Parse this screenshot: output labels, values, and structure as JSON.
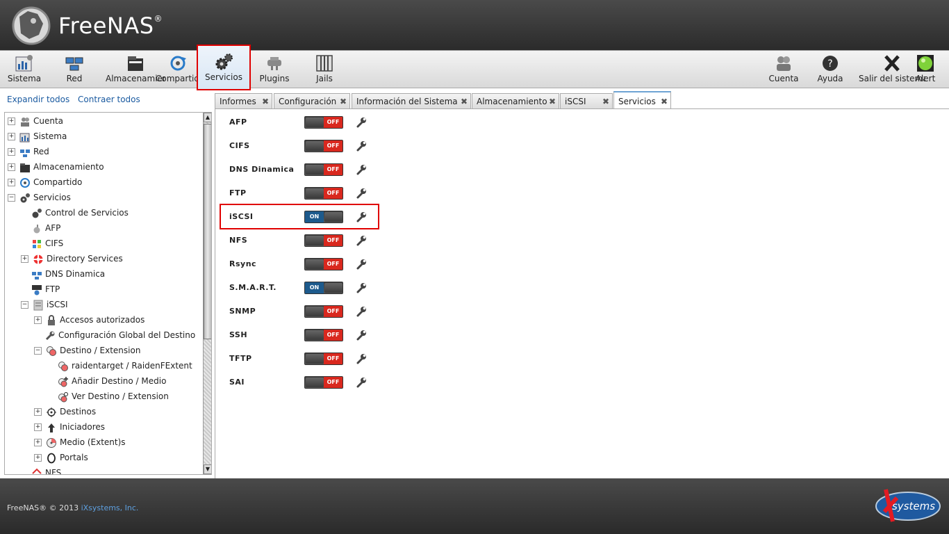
{
  "header": {
    "brand": "FreeNAS",
    "reg": "®"
  },
  "toolbar": {
    "left": [
      {
        "label": "Sistema"
      },
      {
        "label": "Red"
      },
      {
        "label": "Almacenamiento"
      },
      {
        "label": "Compartido"
      },
      {
        "label": "Servicios"
      },
      {
        "label": "Plugins"
      },
      {
        "label": "Jails"
      }
    ],
    "right": [
      {
        "label": "Cuenta"
      },
      {
        "label": "Ayuda"
      },
      {
        "label": "Salir del sistema"
      },
      {
        "label": "Alert"
      }
    ]
  },
  "tree": {
    "expand_all": "Expandir todos",
    "collapse_all": "Contraer todos",
    "items": [
      {
        "label": "Cuenta"
      },
      {
        "label": "Sistema"
      },
      {
        "label": "Red"
      },
      {
        "label": "Almacenamiento"
      },
      {
        "label": "Compartido"
      },
      {
        "label": "Servicios"
      },
      {
        "label": "Control de Servicios"
      },
      {
        "label": "AFP"
      },
      {
        "label": "CIFS"
      },
      {
        "label": "Directory Services"
      },
      {
        "label": "DNS Dinamica"
      },
      {
        "label": "FTP"
      },
      {
        "label": "iSCSI"
      },
      {
        "label": "Accesos autorizados"
      },
      {
        "label": "Configuración Global del Destino"
      },
      {
        "label": "Destino / Extension"
      },
      {
        "label": "raidentarget / RaidenFExtent"
      },
      {
        "label": "Añadir Destino / Medio"
      },
      {
        "label": "Ver Destino / Extension"
      },
      {
        "label": "Destinos"
      },
      {
        "label": "Iniciadores"
      },
      {
        "label": "Medio (Extent)s"
      },
      {
        "label": "Portals"
      },
      {
        "label": "NFS"
      }
    ]
  },
  "tabs": [
    {
      "label": "Informes"
    },
    {
      "label": "Configuración"
    },
    {
      "label": "Información del Sistema"
    },
    {
      "label": "Almacenamiento"
    },
    {
      "label": "iSCSI"
    },
    {
      "label": "Servicios"
    }
  ],
  "toggle_labels": {
    "on": "ON",
    "off": "OFF"
  },
  "services": [
    {
      "name": "AFP",
      "state": "off"
    },
    {
      "name": "CIFS",
      "state": "off"
    },
    {
      "name": "DNS Dinamica",
      "state": "off"
    },
    {
      "name": "FTP",
      "state": "off"
    },
    {
      "name": "iSCSI",
      "state": "on"
    },
    {
      "name": "NFS",
      "state": "off"
    },
    {
      "name": "Rsync",
      "state": "off"
    },
    {
      "name": "S.M.A.R.T.",
      "state": "on"
    },
    {
      "name": "SNMP",
      "state": "off"
    },
    {
      "name": "SSH",
      "state": "off"
    },
    {
      "name": "TFTP",
      "state": "off"
    },
    {
      "name": "SAI",
      "state": "off"
    }
  ],
  "footer": {
    "copyright": "FreeNAS® © 2013 ",
    "company": "iXsystems, Inc.",
    "logo_text": "systems"
  }
}
